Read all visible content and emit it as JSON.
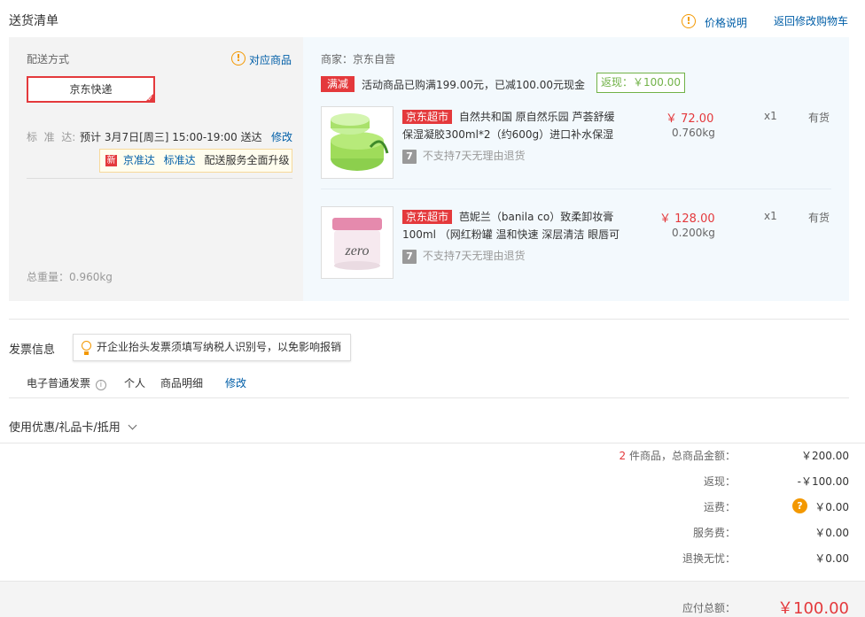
{
  "section_title": "送货清单",
  "price_note": "价格说明",
  "back_to_cart": "返回修改购物车",
  "delivery": {
    "label": "配送方式",
    "matched_goods": "对应商品",
    "method": "京东快递",
    "standard_label": "标  准  达:",
    "standard_value": "预计 3月7日[周三] 15:00-19:00 送达",
    "modify": "修改",
    "new_badge": "新",
    "upgrade_blue1": "京准达",
    "upgrade_blue2": "标准达",
    "upgrade_text": "配送服务全面升级",
    "total_weight": "总重量：0.960kg"
  },
  "merchant": {
    "label": "商家：京东自营",
    "promo_tag": "满减",
    "promo_text": "活动商品已购满199.00元，已减100.00元现金",
    "cashback": "返现：￥100.00"
  },
  "products": [
    {
      "store_tag": "京东超市",
      "name": "自然共和国 原自然乐园 芦荟舒缓保湿凝胶300ml*2（约600g）进口补水保湿",
      "price": "￥ 72.00",
      "weight": "0.760kg",
      "qty": "x1",
      "stock": "有货",
      "return_note": "不支持7天无理由退货",
      "seven": "7"
    },
    {
      "store_tag": "京东超市",
      "name": "芭妮兰（banila co）致柔卸妆膏100ml （网红粉罐 温和快速 深层清洁 眼唇可",
      "price": "￥ 128.00",
      "weight": "0.200kg",
      "qty": "x1",
      "stock": "有货",
      "return_note": "不支持7天无理由退货",
      "seven": "7"
    }
  ],
  "invoice": {
    "title": "发票信息",
    "tip": "开企业抬头发票须填写纳税人识别号，以免影响报销",
    "type": "电子普通发票",
    "person": "个人",
    "detail": "商品明细",
    "modify": "修改"
  },
  "coupon": {
    "label": "使用优惠/礼品卡/抵用"
  },
  "summary": {
    "count": "2",
    "count_text": "件商品，总商品金额：",
    "total": "￥200.00",
    "cashback_label": "返现：",
    "cashback_value": "-￥100.00",
    "freight_label": "运费：",
    "freight_value": "￥0.00",
    "service_label": "服务费：",
    "service_value": "￥0.00",
    "return_label": "退换无忧：",
    "return_value": "￥0.00",
    "payable_label": "应付总额：",
    "payable_value": "￥100.00"
  },
  "colors": {
    "accent_red": "#e4393c",
    "link_blue": "#005ea7",
    "panel_gray": "#f3f3f3",
    "panel_blue": "#f3f9fd",
    "cashback_green": "#71b247"
  }
}
